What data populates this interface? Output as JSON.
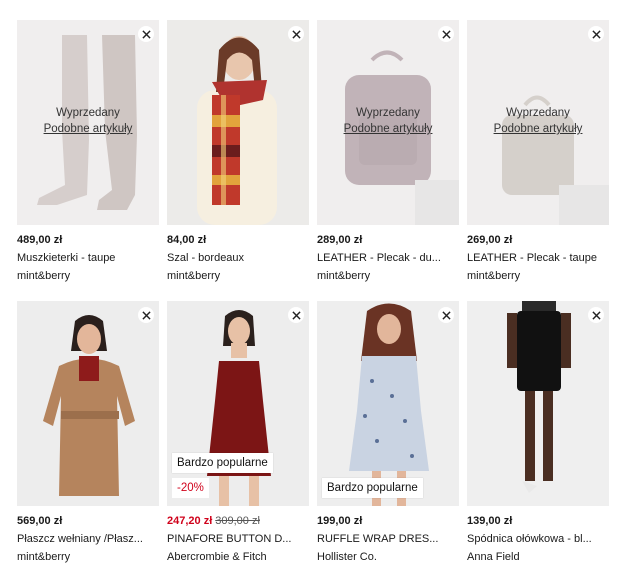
{
  "products": [
    {
      "price": "489,00 zł",
      "title": "Muszkieterki - taupe",
      "brand": "mint&berry",
      "sold_out": "Wyprzedany",
      "similar": "Podobne artykuły"
    },
    {
      "price": "84,00 zł",
      "title": "Szal - bordeaux",
      "brand": "mint&berry"
    },
    {
      "price": "289,00 zł",
      "title": "LEATHER - Plecak - du...",
      "brand": "mint&berry",
      "sold_out": "Wyprzedany",
      "similar": "Podobne artykuły"
    },
    {
      "price": "269,00 zł",
      "title": "LEATHER - Plecak - taupe",
      "brand": "mint&berry",
      "sold_out": "Wyprzedany",
      "similar": "Podobne artykuły"
    },
    {
      "price": "569,00 zł",
      "title": "Płaszcz wełniany /Płasz...",
      "brand": "mint&berry"
    },
    {
      "price": "247,20 zł",
      "old_price": "309,00 zł",
      "title": "PINAFORE BUTTON D...",
      "brand": "Abercrombie & Fitch",
      "badge": "Bardzo popularne",
      "discount": "-20%"
    },
    {
      "price": "199,00 zł",
      "title": "RUFFLE WRAP DRES...",
      "brand": "Hollister Co.",
      "badge": "Bardzo popularne"
    },
    {
      "price": "139,00 zł",
      "title": "Spódnica ołówkowa - bl...",
      "brand": "Anna Field"
    }
  ],
  "icons": {
    "remove": "close-icon"
  },
  "colors": {
    "sale": "#d0021b",
    "thumb_bg": "#f0eeee"
  }
}
